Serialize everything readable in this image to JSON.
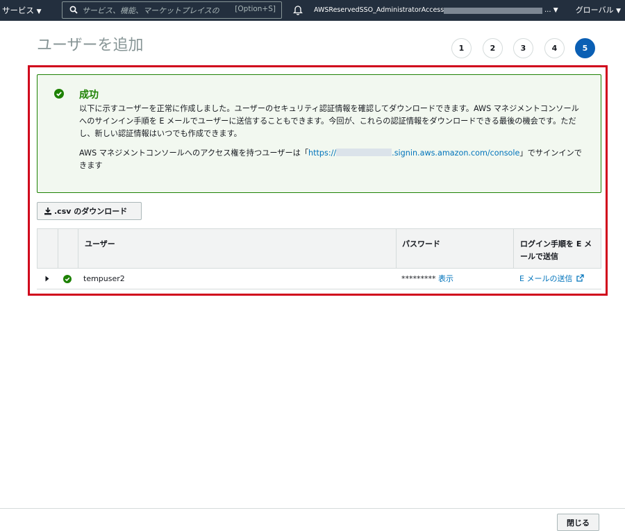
{
  "topnav": {
    "services_label": "サービス",
    "search_placeholder": "サービス、機能、マーケットプレイスの",
    "search_shortcut": "[Option+S]",
    "account_label": "AWSReservedSSO_AdministratorAccess_",
    "account_more": "...",
    "region_label": "グローバル"
  },
  "page": {
    "title": "ユーザーを追加",
    "steps": [
      "1",
      "2",
      "3",
      "4",
      "5"
    ],
    "active_step": "5"
  },
  "success": {
    "title": "成功",
    "message": "以下に示すユーザーを正常に作成しました。ユーザーのセキュリティ認証情報を確認してダウンロードできます。AWS マネジメントコンソールへのサインイン手順を E メールでユーザーに送信することもできます。今回が、これらの認証情報をダウンロードできる最後の機会です。ただし、新しい認証情報はいつでも作成できます。",
    "console_prefix": "AWS マネジメントコンソールへのアクセス権を持つユーザーは「",
    "console_url_start": "https://",
    "console_url_end": ".signin.aws.amazon.com/console",
    "console_suffix": "」でサインインできます"
  },
  "csv_button": ".csv のダウンロード",
  "table": {
    "headers": {
      "user": "ユーザー",
      "password": "パスワード",
      "email": "ログイン手順を E メールで送信"
    },
    "rows": [
      {
        "user": "tempuser2",
        "password_mask": "*********",
        "show_label": "表示",
        "email_label": "E メールの送信"
      }
    ]
  },
  "footer": {
    "close_label": "閉じる"
  },
  "colors": {
    "nav_bg": "#232f3e",
    "success_green": "#1d8102",
    "link_blue": "#0073bb",
    "active_step": "#0a5fb4",
    "highlight_red": "#d0021b"
  }
}
